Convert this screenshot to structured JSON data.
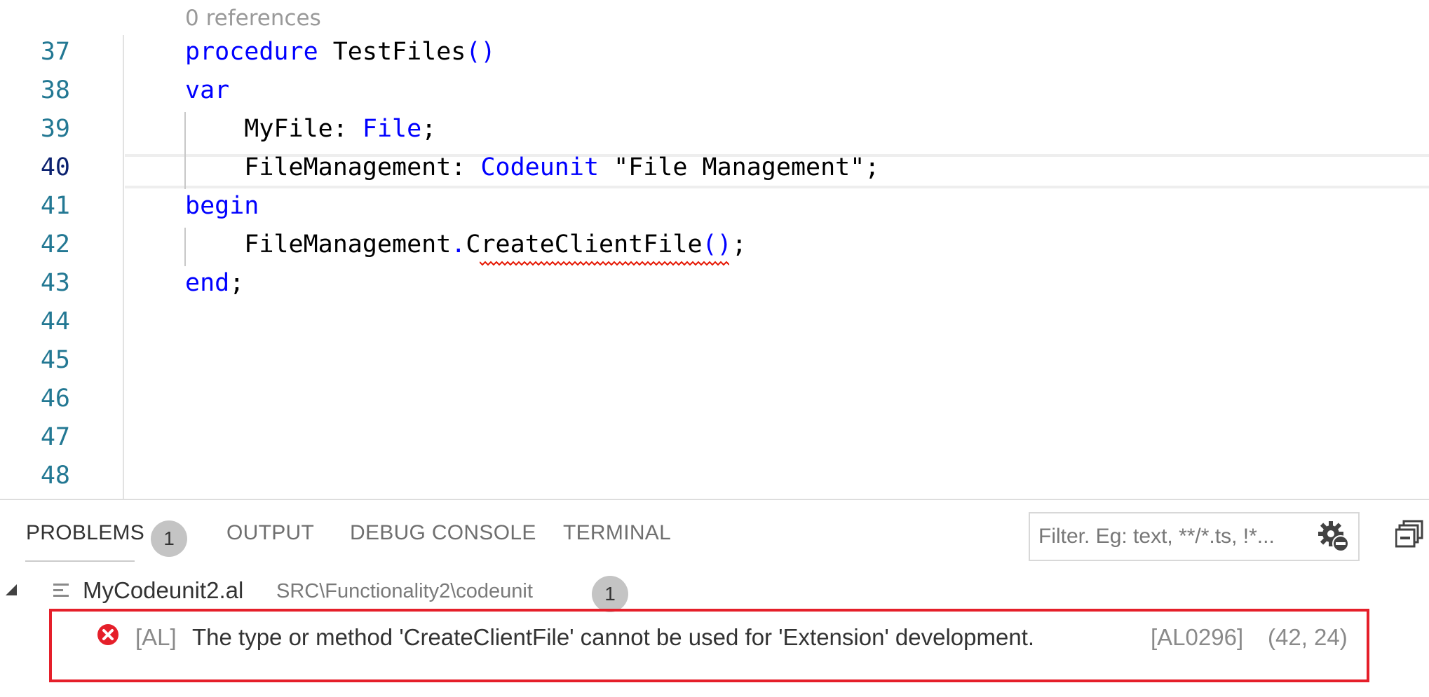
{
  "editor": {
    "codelens": "0 references",
    "active_line": "40",
    "lines": [
      {
        "num": "37",
        "tokens": [
          {
            "t": "procedure",
            "c": "#0000ff"
          },
          {
            "t": " TestFiles",
            "c": "#000000"
          },
          {
            "t": "()",
            "c": "#0000ff"
          }
        ]
      },
      {
        "num": "38",
        "tokens": [
          {
            "t": "var",
            "c": "#0000ff"
          }
        ]
      },
      {
        "num": "39",
        "tokens": [
          {
            "t": "    MyFile: ",
            "c": "#000000"
          },
          {
            "t": "File",
            "c": "#0000ff"
          },
          {
            "t": ";",
            "c": "#000000"
          }
        ]
      },
      {
        "num": "40",
        "tokens": [
          {
            "t": "    FileManagement: ",
            "c": "#000000"
          },
          {
            "t": "Codeunit",
            "c": "#0000ff"
          },
          {
            "t": " \"File Management\";",
            "c": "#000000"
          }
        ]
      },
      {
        "num": "41",
        "tokens": [
          {
            "t": "begin",
            "c": "#0000ff"
          }
        ]
      },
      {
        "num": "42",
        "tokens": [
          {
            "t": "    FileManagement",
            "c": "#000000"
          },
          {
            "t": ".",
            "c": "#0000ff"
          },
          {
            "t": "CreateClientFile",
            "c": "#000000"
          },
          {
            "t": "()",
            "c": "#0000ff"
          },
          {
            "t": ";",
            "c": "#000000"
          }
        ]
      },
      {
        "num": "43",
        "tokens": [
          {
            "t": "end",
            "c": "#0000ff"
          },
          {
            "t": ";",
            "c": "#000000"
          }
        ]
      },
      {
        "num": "44",
        "tokens": []
      },
      {
        "num": "45",
        "tokens": []
      },
      {
        "num": "46",
        "tokens": []
      },
      {
        "num": "47",
        "tokens": []
      },
      {
        "num": "48",
        "tokens": []
      }
    ]
  },
  "panel": {
    "tabs": {
      "problems": "PROBLEMS",
      "problems_count": "1",
      "output": "OUTPUT",
      "debug_console": "DEBUG CONSOLE",
      "terminal": "TERMINAL"
    },
    "filter_placeholder": "Filter. Eg: text, **/*.ts, !*...",
    "file": {
      "name": "MyCodeunit2.al",
      "path": "SRC\\Functionality2\\codeunit",
      "count": "1"
    },
    "problem": {
      "source": "[AL]",
      "message": "The type or method 'CreateClientFile' cannot be used for 'Extension' development.",
      "code": "[AL0296]",
      "position": "(42, 24)"
    },
    "colors": {
      "error": "#e51f2a",
      "keyword": "#0000ff",
      "line_number": "#237893"
    }
  }
}
